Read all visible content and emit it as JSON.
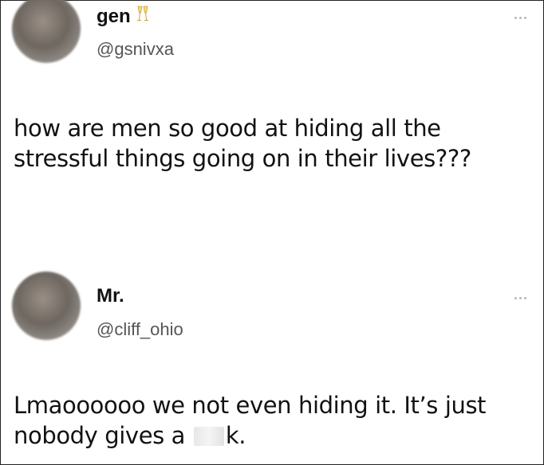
{
  "tweets": [
    {
      "display_name": "gen",
      "name_emoji": "🥂",
      "handle": "@gsnivxa",
      "text": "how are men so good at hiding all the stressful things going on in their lives???"
    },
    {
      "display_name": "Mr.",
      "handle": "@cliff_ohio",
      "text_before_censor": "Lmaoooooo we not even hiding it. It’s just nobody gives a ",
      "text_after_censor": "k."
    }
  ],
  "icons": {
    "more": "more-options-icon",
    "emoji": "champagne-glasses-icon"
  }
}
